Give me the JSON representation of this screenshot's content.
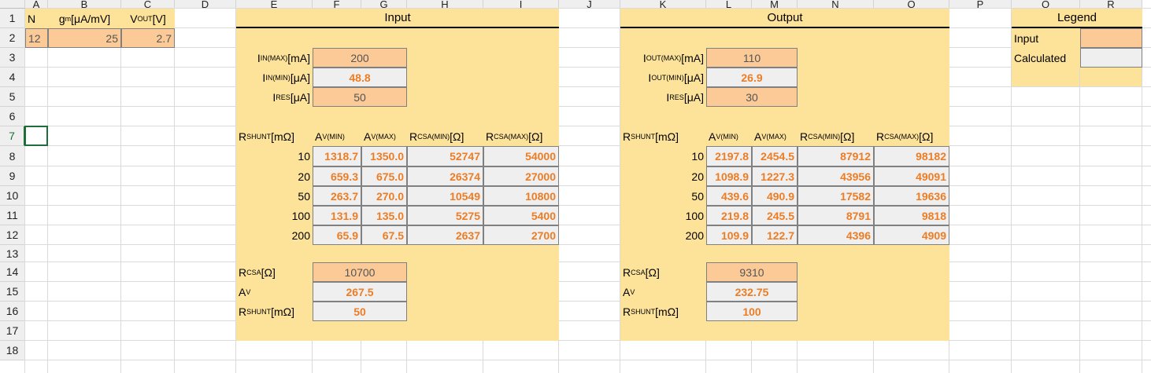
{
  "columns": [
    "A",
    "B",
    "C",
    "D",
    "E",
    "F",
    "G",
    "H",
    "I",
    "J",
    "K",
    "L",
    "M",
    "N",
    "O",
    "P",
    "Q",
    "R"
  ],
  "rows": [
    "1",
    "2",
    "3",
    "4",
    "5",
    "6",
    "7",
    "8",
    "9",
    "10",
    "11",
    "12",
    "13",
    "14",
    "15",
    "16",
    "17",
    "18"
  ],
  "params": {
    "h_n": "N",
    "h_gm": "gm [μA/mV]",
    "h_vout": "VOUT [V]",
    "n": "12",
    "gm": "25",
    "vout": "2.7"
  },
  "input": {
    "title": "Input",
    "l_imax": "IIN(MAX) [mA]",
    "l_imin": "IIN(MIN) [μA]",
    "l_ires": "IRES [μA]",
    "imax": "200",
    "imin": "48.8",
    "ires": "50",
    "table": {
      "headers": [
        "RSHUNT [mΩ]",
        "AV(MIN)",
        "AV(MAX)",
        "RCSA(MIN) [Ω]",
        "RCSA(MAX) [Ω]"
      ],
      "rows": [
        [
          "10",
          "1318.7",
          "1350.0",
          "52747",
          "54000"
        ],
        [
          "20",
          "659.3",
          "675.0",
          "26374",
          "27000"
        ],
        [
          "50",
          "263.7",
          "270.0",
          "10549",
          "10800"
        ],
        [
          "100",
          "131.9",
          "135.0",
          "5275",
          "5400"
        ],
        [
          "200",
          "65.9",
          "67.5",
          "2637",
          "2700"
        ]
      ]
    },
    "l_rcsa": "RCSA [Ω]",
    "l_av": "AV",
    "l_rshunt": "RSHUNT [mΩ]",
    "rcsa": "10700",
    "av": "267.5",
    "rshunt": "50"
  },
  "output": {
    "title": "Output",
    "l_imax": "IOUT(MAX) [mA]",
    "l_imin": "IOUT(MIN) [μA]",
    "l_ires": "IRES [μA]",
    "imax": "110",
    "imin": "26.9",
    "ires": "30",
    "table": {
      "headers": [
        "RSHUNT [mΩ]",
        "AV(MIN)",
        "AV(MAX)",
        "RCSA(MIN) [Ω]",
        "RCSA(MAX) [Ω]"
      ],
      "rows": [
        [
          "10",
          "2197.8",
          "2454.5",
          "87912",
          "98182"
        ],
        [
          "20",
          "1098.9",
          "1227.3",
          "43956",
          "49091"
        ],
        [
          "50",
          "439.6",
          "490.9",
          "17582",
          "19636"
        ],
        [
          "100",
          "219.8",
          "245.5",
          "8791",
          "9818"
        ],
        [
          "200",
          "109.9",
          "122.7",
          "4396",
          "4909"
        ]
      ]
    },
    "l_rcsa": "RCSA [Ω]",
    "l_av": "AV",
    "l_rshunt": "RSHUNT [mΩ]",
    "rcsa": "9310",
    "av": "232.75",
    "rshunt": "100"
  },
  "legend": {
    "title": "Legend",
    "input": "Input",
    "calculated": "Calculated"
  },
  "colors": {
    "input_fill": "#fcca97",
    "calculated_fill": "#efefef",
    "section_fill": "#fde39a",
    "value_text": "#ed7d24"
  }
}
